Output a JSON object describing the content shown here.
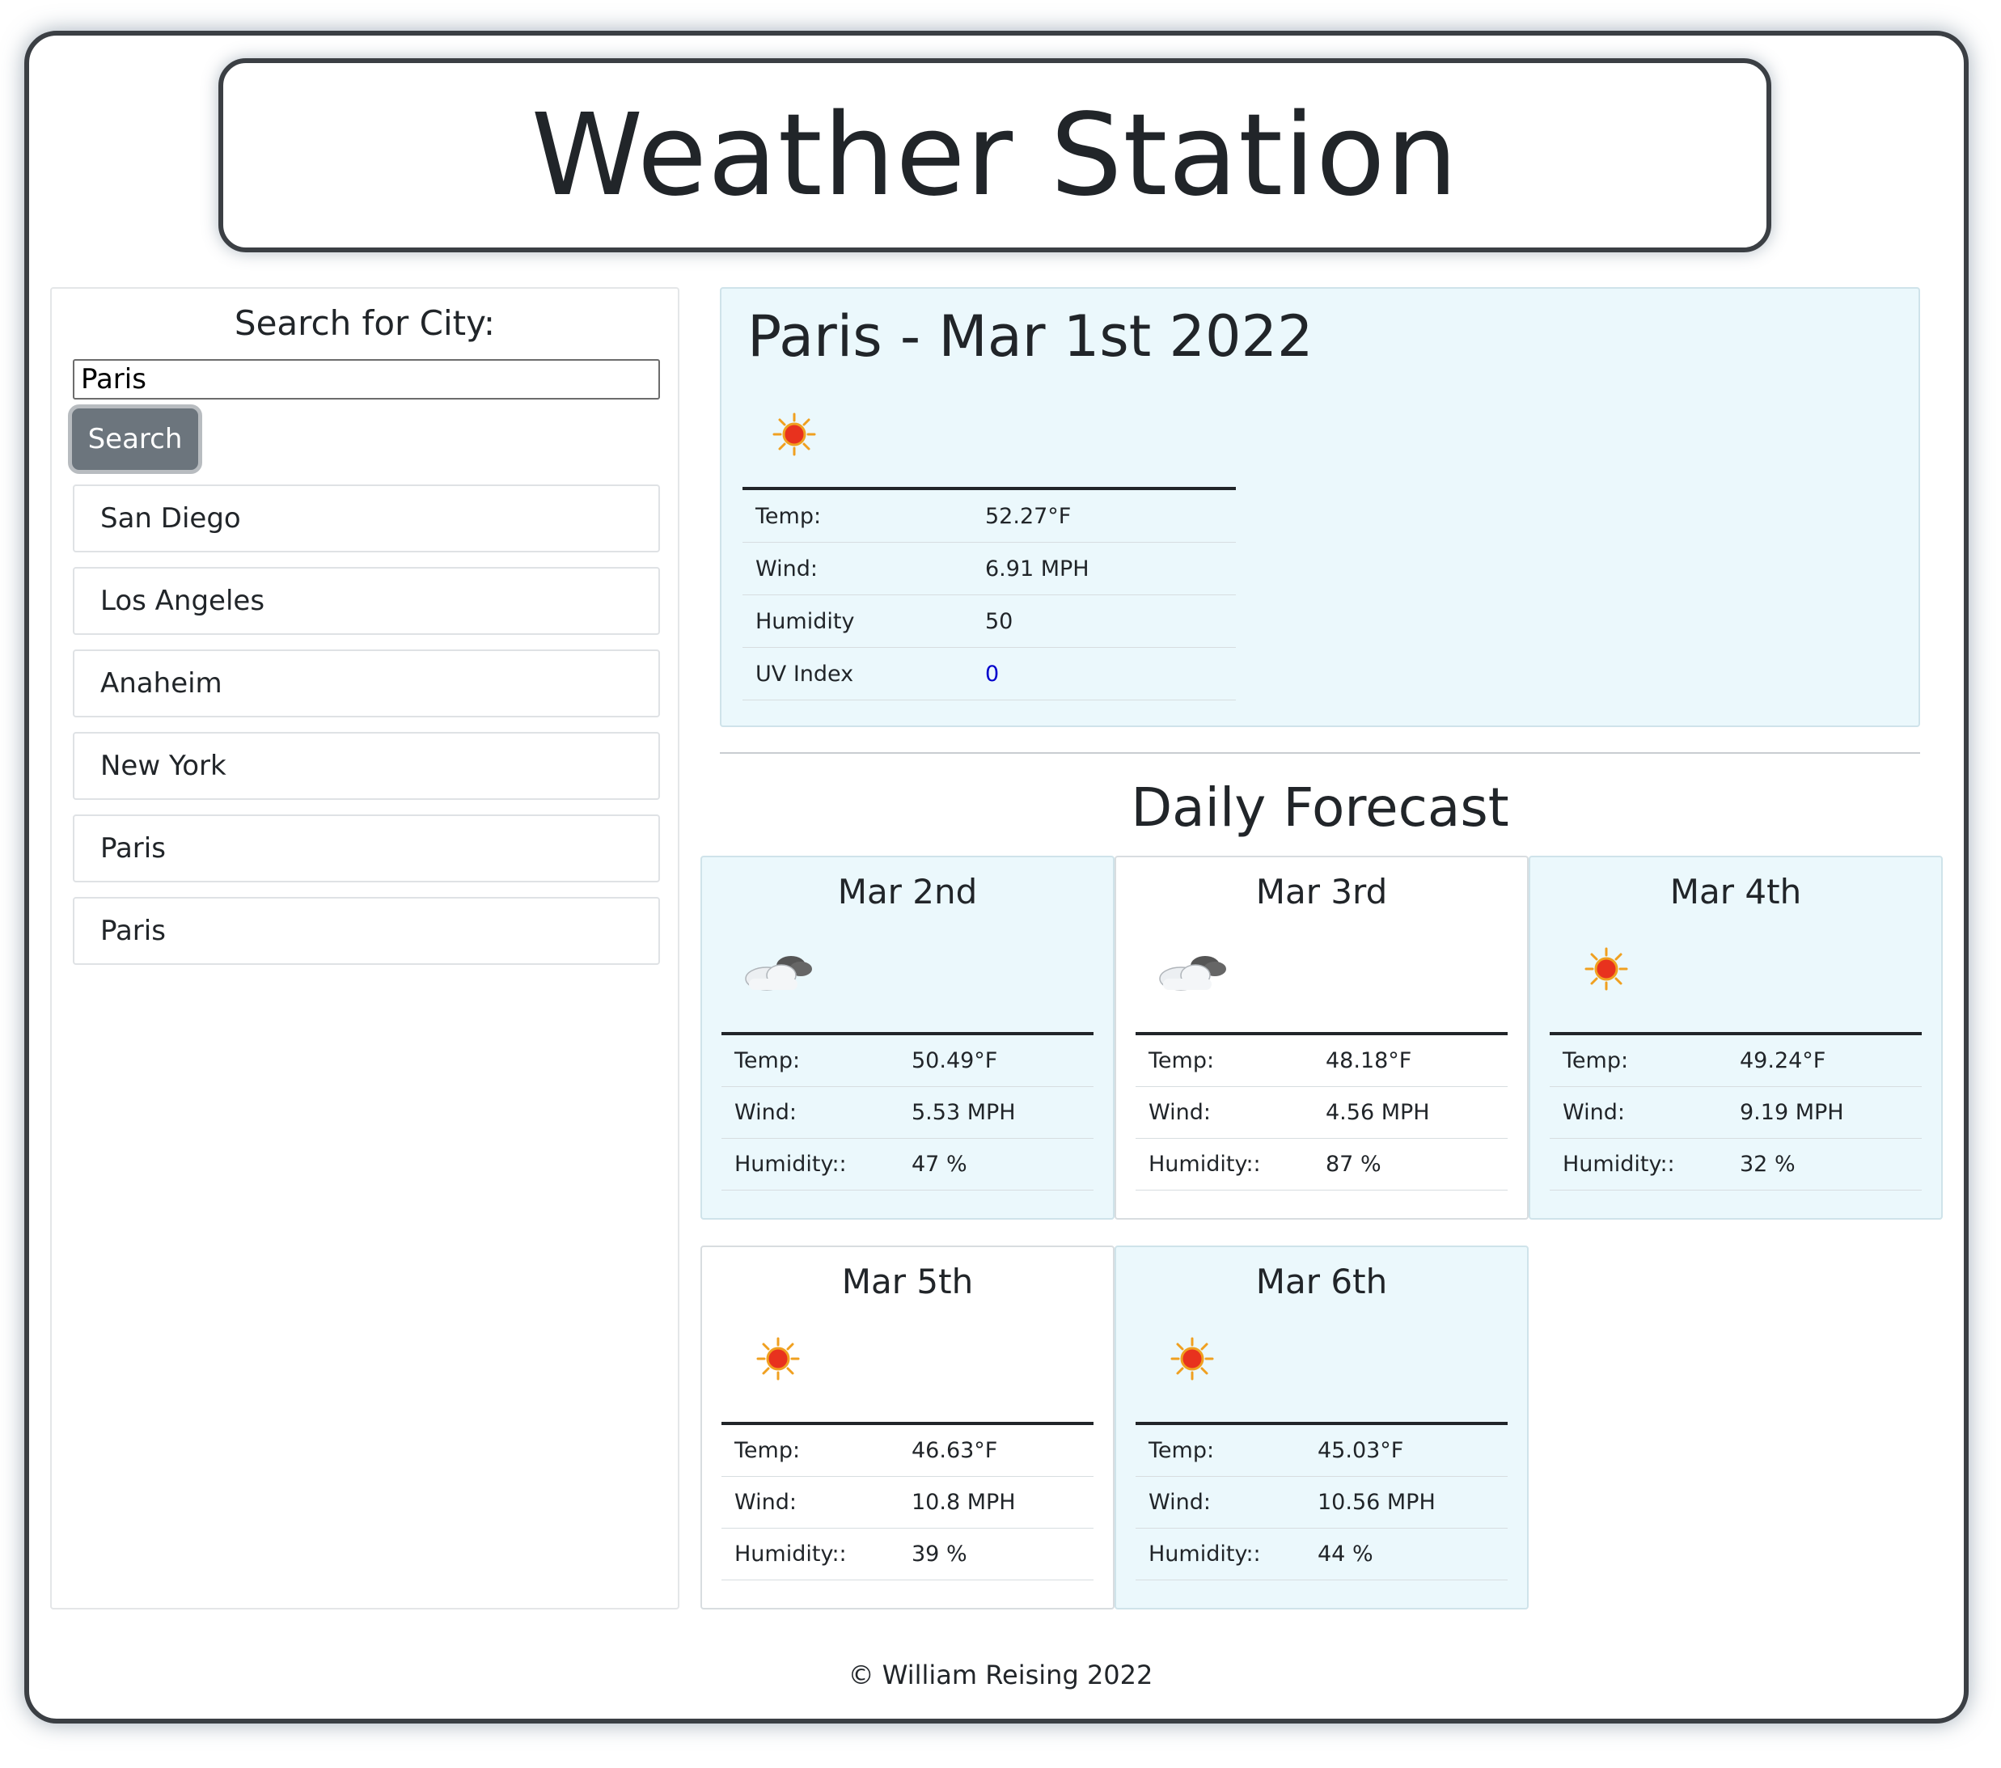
{
  "header": {
    "title": "Weather Station"
  },
  "search": {
    "label": "Search for City:",
    "value": "Paris",
    "button_label": "Search"
  },
  "history": [
    {
      "label": "San Diego"
    },
    {
      "label": "Los Angeles"
    },
    {
      "label": "Anaheim"
    },
    {
      "label": "New York"
    },
    {
      "label": "Paris"
    },
    {
      "label": "Paris"
    }
  ],
  "current": {
    "title": "Paris - Mar 1st 2022",
    "icon": "sun-icon",
    "temp_label": "Temp:",
    "temp": "52.27°F",
    "wind_label": "Wind:",
    "wind": "6.91 MPH",
    "humidity_label": "Humidity",
    "humidity": "50",
    "uv_label": "UV Index",
    "uv": "0",
    "uv_color": "#0000cc"
  },
  "forecast": {
    "title": "Daily Forecast",
    "days": [
      {
        "date": "Mar 2nd",
        "icon": "cloud-icon",
        "temp_label": "Temp:",
        "temp": "50.49°F",
        "wind_label": "Wind:",
        "wind": "5.53 MPH",
        "humidity_label": "Humidity::",
        "humidity": "47 %"
      },
      {
        "date": "Mar 3rd",
        "icon": "cloud-icon",
        "temp_label": "Temp:",
        "temp": "48.18°F",
        "wind_label": "Wind:",
        "wind": "4.56 MPH",
        "humidity_label": "Humidity::",
        "humidity": "87 %"
      },
      {
        "date": "Mar 4th",
        "icon": "sun-icon",
        "temp_label": "Temp:",
        "temp": "49.24°F",
        "wind_label": "Wind:",
        "wind": "9.19 MPH",
        "humidity_label": "Humidity::",
        "humidity": "32 %"
      },
      {
        "date": "Mar 5th",
        "icon": "sun-icon",
        "temp_label": "Temp:",
        "temp": "46.63°F",
        "wind_label": "Wind:",
        "wind": "10.8 MPH",
        "humidity_label": "Humidity::",
        "humidity": "39 %"
      },
      {
        "date": "Mar 6th",
        "icon": "sun-icon",
        "temp_label": "Temp:",
        "temp": "45.03°F",
        "wind_label": "Wind:",
        "wind": "10.56 MPH",
        "humidity_label": "Humidity::",
        "humidity": "44 %"
      }
    ]
  },
  "colors": {
    "card_tint": "#ebf8fc",
    "button": "#6c757d",
    "frame": "#3b3f44"
  },
  "footer": {
    "text": "© William Reising 2022"
  }
}
